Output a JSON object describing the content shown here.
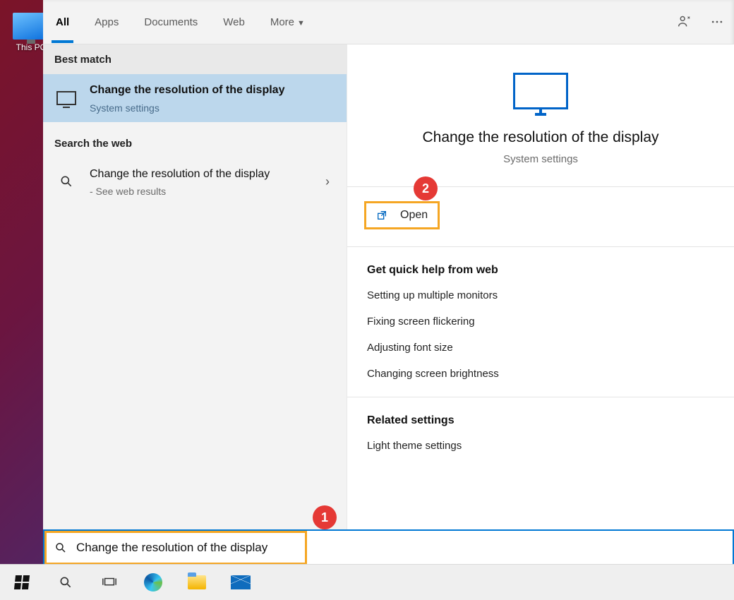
{
  "desktop": {
    "this_pc_label": "This PC"
  },
  "tabs": {
    "all": "All",
    "apps": "Apps",
    "documents": "Documents",
    "web": "Web",
    "more": "More"
  },
  "sections": {
    "best_match": "Best match",
    "search_web": "Search the web"
  },
  "best_result": {
    "title": "Change the resolution of the display",
    "subtitle": "System settings"
  },
  "web_result": {
    "title": "Change the resolution of the display",
    "subtitle": "- See web results"
  },
  "preview": {
    "title": "Change the resolution of the display",
    "subtitle": "System settings",
    "open_label": "Open",
    "help_heading": "Get quick help from web",
    "help_links": [
      "Setting up multiple monitors",
      "Fixing screen flickering",
      "Adjusting font size",
      "Changing screen brightness"
    ],
    "related_heading": "Related settings",
    "related_links": [
      "Light theme settings"
    ]
  },
  "search": {
    "value": "Change the resolution of the display"
  },
  "annotations": {
    "step1": "1",
    "step2": "2"
  }
}
